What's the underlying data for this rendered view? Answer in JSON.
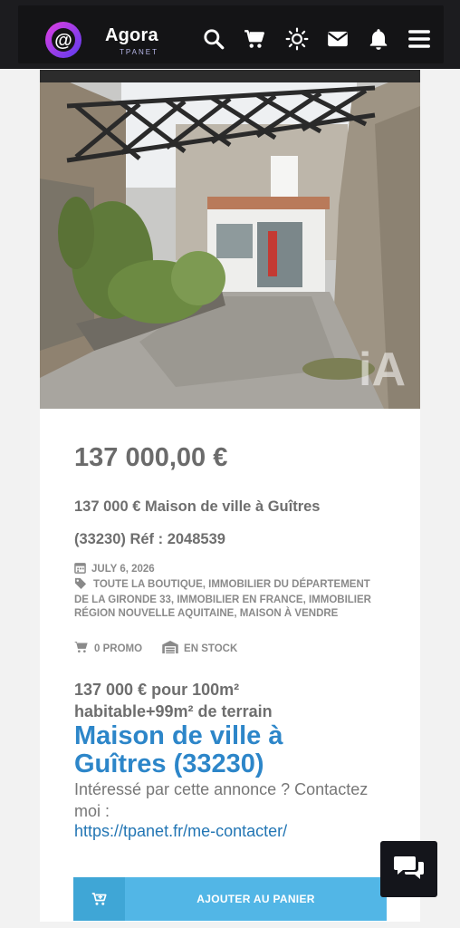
{
  "header": {
    "logo_text": "Agora",
    "logo_sub": "TPANET",
    "icons": [
      "search-icon",
      "cart-icon",
      "theme-sun-icon",
      "mail-icon",
      "bell-icon",
      "menu-icon"
    ]
  },
  "product": {
    "price": "137 000,00 €",
    "title": "137 000 € Maison de ville à Guîtres (33230) Réf : 2048539",
    "date": "JULY 6, 2026",
    "categories": "TOUTE LA BOUTIQUE, IMMOBILIER DU DÉPARTEMENT DE LA GIRONDE 33, IMMOBILIER EN FRANCE, IMMOBILIER RÉGION NOUVELLE AQUITAINE, MAISON À VENDRE",
    "promo": "0 PROMO",
    "stock": "EN STOCK",
    "photo_watermark": "iA"
  },
  "description": {
    "intro": "137 000 € pour 100m² habitable+99m² de terrain",
    "heading": "Maison de ville à Guîtres (33230)",
    "contact_text": "Intéressé par cette annonce ? Contactez moi :",
    "contact_link": "https://tpanet.fr/me-contacter/"
  },
  "actions": {
    "add_to_cart": "AJOUTER AU PANIER"
  },
  "colors": {
    "accent_blue": "#2d86c9",
    "cart_button": "#52b6e6",
    "header_bg": "#1c1c1f"
  }
}
